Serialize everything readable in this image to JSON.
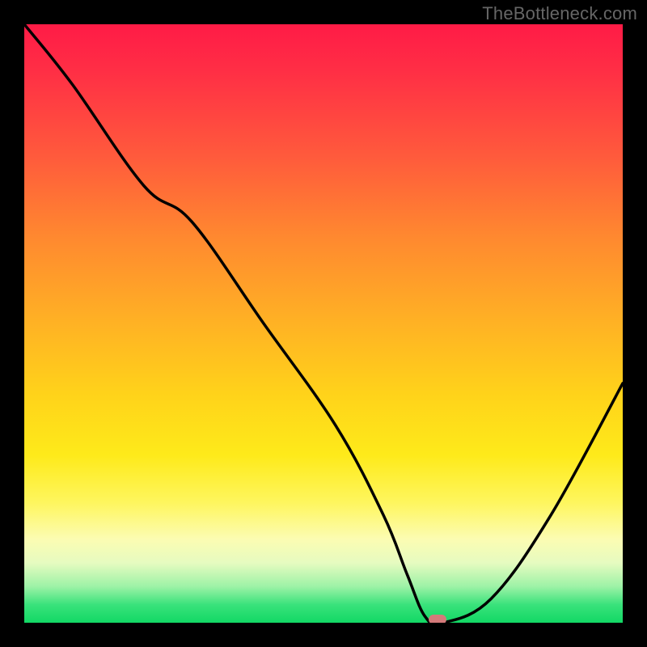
{
  "watermark": "TheBottleneck.com",
  "chart_data": {
    "type": "line",
    "title": "",
    "xlabel": "",
    "ylabel": "",
    "xlim": [
      0,
      100
    ],
    "ylim": [
      0,
      100
    ],
    "grid": false,
    "legend": false,
    "background": "heat-gradient-red-to-green",
    "series": [
      {
        "name": "bottleneck-curve",
        "x": [
          0,
          8,
          20,
          28,
          40,
          52,
          60,
          64,
          67,
          70,
          78,
          88,
          100
        ],
        "values": [
          100,
          90,
          73,
          67,
          50,
          33,
          18,
          8,
          1,
          0,
          4,
          18,
          40
        ]
      }
    ],
    "marker": {
      "x": 69,
      "y": 0.5,
      "shape": "pill",
      "color": "#d47a7a"
    },
    "colors": {
      "curve": "#000000",
      "frame": "#000000",
      "gradient_stops": [
        "#ff1b46",
        "#ff8a2f",
        "#ffd31a",
        "#fcfcb2",
        "#12d865"
      ]
    }
  }
}
